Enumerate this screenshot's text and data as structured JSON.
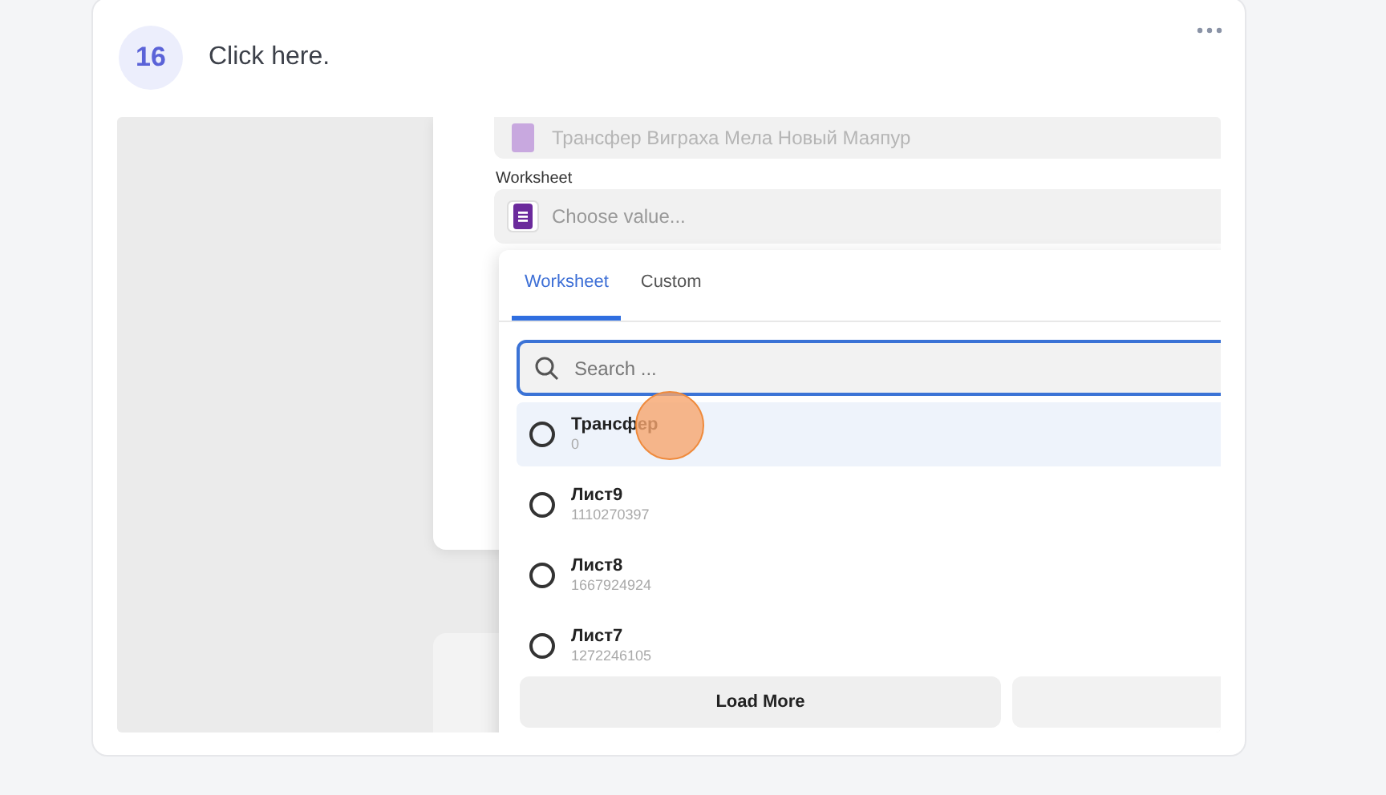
{
  "step": {
    "number": "16",
    "instruction": "Click here."
  },
  "screenshot": {
    "top_field": {
      "value": "Трансфер Виграха Мела Новый Маяпур"
    },
    "worksheet_field": {
      "label": "Worksheet",
      "placeholder": "Choose value..."
    },
    "dropdown": {
      "tabs": [
        {
          "label": "Worksheet",
          "selected": true
        },
        {
          "label": "Custom",
          "selected": false
        }
      ],
      "search": {
        "placeholder": "Search ..."
      },
      "options": [
        {
          "name": "Трансфер",
          "id": "0",
          "selected": false,
          "hovered": true
        },
        {
          "name": "Лист9",
          "id": "1110270397",
          "selected": false,
          "hovered": false
        },
        {
          "name": "Лист8",
          "id": "1667924924",
          "selected": false,
          "hovered": false
        },
        {
          "name": "Лист7",
          "id": "1272246105",
          "selected": false,
          "hovered": false
        }
      ],
      "buttons": [
        "Load More"
      ]
    }
  }
}
